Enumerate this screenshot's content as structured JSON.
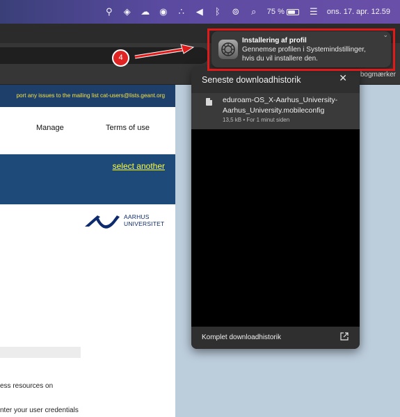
{
  "menubar": {
    "icons": [
      "location-icon",
      "layers-icon",
      "cloud-sync-icon",
      "sync-icon",
      "activity-icon",
      "volume-icon",
      "bluetooth-icon",
      "vpn-icon",
      "search-icon",
      "control-center-icon"
    ],
    "battery_percent_label": "75 %",
    "battery_level": 0.75,
    "datetime": "ons. 17. apr. 12.59"
  },
  "bookmarks": {
    "all_bookmarks_label": "bogmærker"
  },
  "page": {
    "notice_text": "port any issues to the mailing list cat-users@lists.geant.org",
    "nav": {
      "manage": "Manage",
      "terms": "Terms of use"
    },
    "select_another": "select another",
    "logo": {
      "line1": "AARHUS",
      "line2": "UNIVERSITET"
    },
    "body_line1": "ess resources on",
    "body_line2": "nter your user credentials"
  },
  "downloads": {
    "title": "Seneste downloadhistorik",
    "item": {
      "name_line1": "eduroam-OS_X-Aarhus_University-",
      "name_line2": "Aarhus_University.mobileconfig",
      "meta": "13,5 kB • For 1 minut siden"
    },
    "footer": "Komplet downloadhistorik"
  },
  "notification": {
    "title": "Installering af profil",
    "line1": "Gennemse profilen i Systemindstillinger,",
    "line2": "hvis du vil installere den."
  },
  "annotation": {
    "step": "4",
    "color": "#e01919"
  }
}
